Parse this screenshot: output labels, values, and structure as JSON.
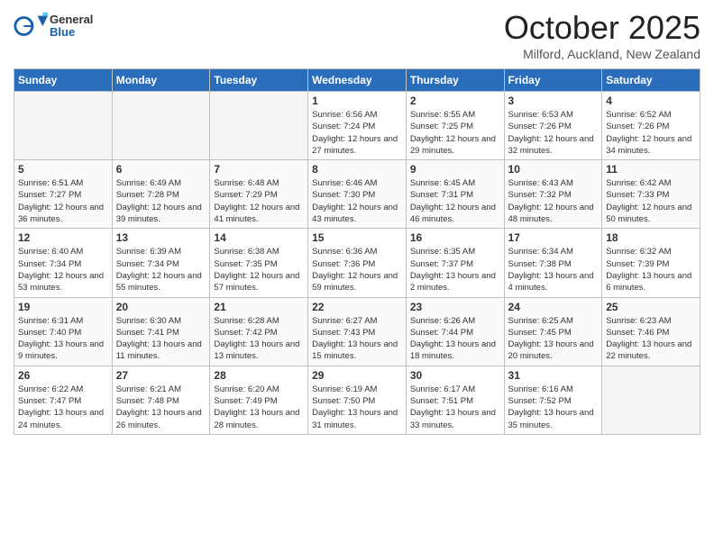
{
  "header": {
    "logo_general": "General",
    "logo_blue": "Blue",
    "title": "October 2025",
    "location": "Milford, Auckland, New Zealand"
  },
  "days_of_week": [
    "Sunday",
    "Monday",
    "Tuesday",
    "Wednesday",
    "Thursday",
    "Friday",
    "Saturday"
  ],
  "weeks": [
    [
      {
        "day": "",
        "empty": true
      },
      {
        "day": "",
        "empty": true
      },
      {
        "day": "",
        "empty": true
      },
      {
        "day": "1",
        "sunrise": "Sunrise: 6:56 AM",
        "sunset": "Sunset: 7:24 PM",
        "daylight": "Daylight: 12 hours and 27 minutes."
      },
      {
        "day": "2",
        "sunrise": "Sunrise: 6:55 AM",
        "sunset": "Sunset: 7:25 PM",
        "daylight": "Daylight: 12 hours and 29 minutes."
      },
      {
        "day": "3",
        "sunrise": "Sunrise: 6:53 AM",
        "sunset": "Sunset: 7:26 PM",
        "daylight": "Daylight: 12 hours and 32 minutes."
      },
      {
        "day": "4",
        "sunrise": "Sunrise: 6:52 AM",
        "sunset": "Sunset: 7:26 PM",
        "daylight": "Daylight: 12 hours and 34 minutes."
      }
    ],
    [
      {
        "day": "5",
        "sunrise": "Sunrise: 6:51 AM",
        "sunset": "Sunset: 7:27 PM",
        "daylight": "Daylight: 12 hours and 36 minutes."
      },
      {
        "day": "6",
        "sunrise": "Sunrise: 6:49 AM",
        "sunset": "Sunset: 7:28 PM",
        "daylight": "Daylight: 12 hours and 39 minutes."
      },
      {
        "day": "7",
        "sunrise": "Sunrise: 6:48 AM",
        "sunset": "Sunset: 7:29 PM",
        "daylight": "Daylight: 12 hours and 41 minutes."
      },
      {
        "day": "8",
        "sunrise": "Sunrise: 6:46 AM",
        "sunset": "Sunset: 7:30 PM",
        "daylight": "Daylight: 12 hours and 43 minutes."
      },
      {
        "day": "9",
        "sunrise": "Sunrise: 6:45 AM",
        "sunset": "Sunset: 7:31 PM",
        "daylight": "Daylight: 12 hours and 46 minutes."
      },
      {
        "day": "10",
        "sunrise": "Sunrise: 6:43 AM",
        "sunset": "Sunset: 7:32 PM",
        "daylight": "Daylight: 12 hours and 48 minutes."
      },
      {
        "day": "11",
        "sunrise": "Sunrise: 6:42 AM",
        "sunset": "Sunset: 7:33 PM",
        "daylight": "Daylight: 12 hours and 50 minutes."
      }
    ],
    [
      {
        "day": "12",
        "sunrise": "Sunrise: 6:40 AM",
        "sunset": "Sunset: 7:34 PM",
        "daylight": "Daylight: 12 hours and 53 minutes."
      },
      {
        "day": "13",
        "sunrise": "Sunrise: 6:39 AM",
        "sunset": "Sunset: 7:34 PM",
        "daylight": "Daylight: 12 hours and 55 minutes."
      },
      {
        "day": "14",
        "sunrise": "Sunrise: 6:38 AM",
        "sunset": "Sunset: 7:35 PM",
        "daylight": "Daylight: 12 hours and 57 minutes."
      },
      {
        "day": "15",
        "sunrise": "Sunrise: 6:36 AM",
        "sunset": "Sunset: 7:36 PM",
        "daylight": "Daylight: 12 hours and 59 minutes."
      },
      {
        "day": "16",
        "sunrise": "Sunrise: 6:35 AM",
        "sunset": "Sunset: 7:37 PM",
        "daylight": "Daylight: 13 hours and 2 minutes."
      },
      {
        "day": "17",
        "sunrise": "Sunrise: 6:34 AM",
        "sunset": "Sunset: 7:38 PM",
        "daylight": "Daylight: 13 hours and 4 minutes."
      },
      {
        "day": "18",
        "sunrise": "Sunrise: 6:32 AM",
        "sunset": "Sunset: 7:39 PM",
        "daylight": "Daylight: 13 hours and 6 minutes."
      }
    ],
    [
      {
        "day": "19",
        "sunrise": "Sunrise: 6:31 AM",
        "sunset": "Sunset: 7:40 PM",
        "daylight": "Daylight: 13 hours and 9 minutes."
      },
      {
        "day": "20",
        "sunrise": "Sunrise: 6:30 AM",
        "sunset": "Sunset: 7:41 PM",
        "daylight": "Daylight: 13 hours and 11 minutes."
      },
      {
        "day": "21",
        "sunrise": "Sunrise: 6:28 AM",
        "sunset": "Sunset: 7:42 PM",
        "daylight": "Daylight: 13 hours and 13 minutes."
      },
      {
        "day": "22",
        "sunrise": "Sunrise: 6:27 AM",
        "sunset": "Sunset: 7:43 PM",
        "daylight": "Daylight: 13 hours and 15 minutes."
      },
      {
        "day": "23",
        "sunrise": "Sunrise: 6:26 AM",
        "sunset": "Sunset: 7:44 PM",
        "daylight": "Daylight: 13 hours and 18 minutes."
      },
      {
        "day": "24",
        "sunrise": "Sunrise: 6:25 AM",
        "sunset": "Sunset: 7:45 PM",
        "daylight": "Daylight: 13 hours and 20 minutes."
      },
      {
        "day": "25",
        "sunrise": "Sunrise: 6:23 AM",
        "sunset": "Sunset: 7:46 PM",
        "daylight": "Daylight: 13 hours and 22 minutes."
      }
    ],
    [
      {
        "day": "26",
        "sunrise": "Sunrise: 6:22 AM",
        "sunset": "Sunset: 7:47 PM",
        "daylight": "Daylight: 13 hours and 24 minutes."
      },
      {
        "day": "27",
        "sunrise": "Sunrise: 6:21 AM",
        "sunset": "Sunset: 7:48 PM",
        "daylight": "Daylight: 13 hours and 26 minutes."
      },
      {
        "day": "28",
        "sunrise": "Sunrise: 6:20 AM",
        "sunset": "Sunset: 7:49 PM",
        "daylight": "Daylight: 13 hours and 28 minutes."
      },
      {
        "day": "29",
        "sunrise": "Sunrise: 6:19 AM",
        "sunset": "Sunset: 7:50 PM",
        "daylight": "Daylight: 13 hours and 31 minutes."
      },
      {
        "day": "30",
        "sunrise": "Sunrise: 6:17 AM",
        "sunset": "Sunset: 7:51 PM",
        "daylight": "Daylight: 13 hours and 33 minutes."
      },
      {
        "day": "31",
        "sunrise": "Sunrise: 6:16 AM",
        "sunset": "Sunset: 7:52 PM",
        "daylight": "Daylight: 13 hours and 35 minutes."
      },
      {
        "day": "",
        "empty": true
      }
    ]
  ]
}
